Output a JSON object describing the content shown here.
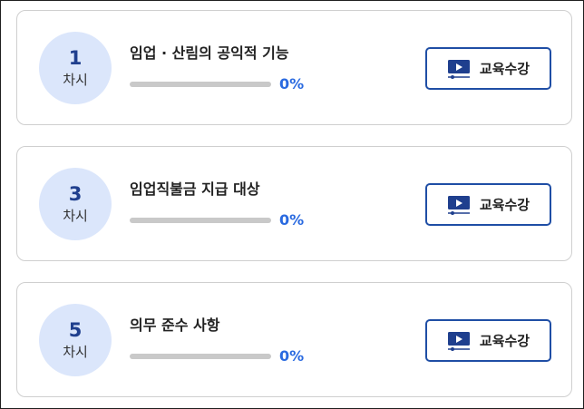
{
  "lessons": [
    {
      "number": "1",
      "unit": "차시",
      "title": "임업 · 산림의 공익적 기능",
      "progress_percent": 0,
      "percent_text": "0%",
      "button_label": "교육수강"
    },
    {
      "number": "3",
      "unit": "차시",
      "title": "임업직불금 지급 대상",
      "progress_percent": 0,
      "percent_text": "0%",
      "button_label": "교육수강"
    },
    {
      "number": "5",
      "unit": "차시",
      "title": "의무 준수 사항",
      "progress_percent": 0,
      "percent_text": "0%",
      "button_label": "교육수강"
    }
  ],
  "icons": {
    "button_icon": "video-play-icon"
  },
  "colors": {
    "accent": "#2a6ae0",
    "badge_bg": "#dbe6fb",
    "badge_text": "#1f3f8e",
    "button_border": "#1f4ea5",
    "progress_track": "#c9c9c9"
  }
}
